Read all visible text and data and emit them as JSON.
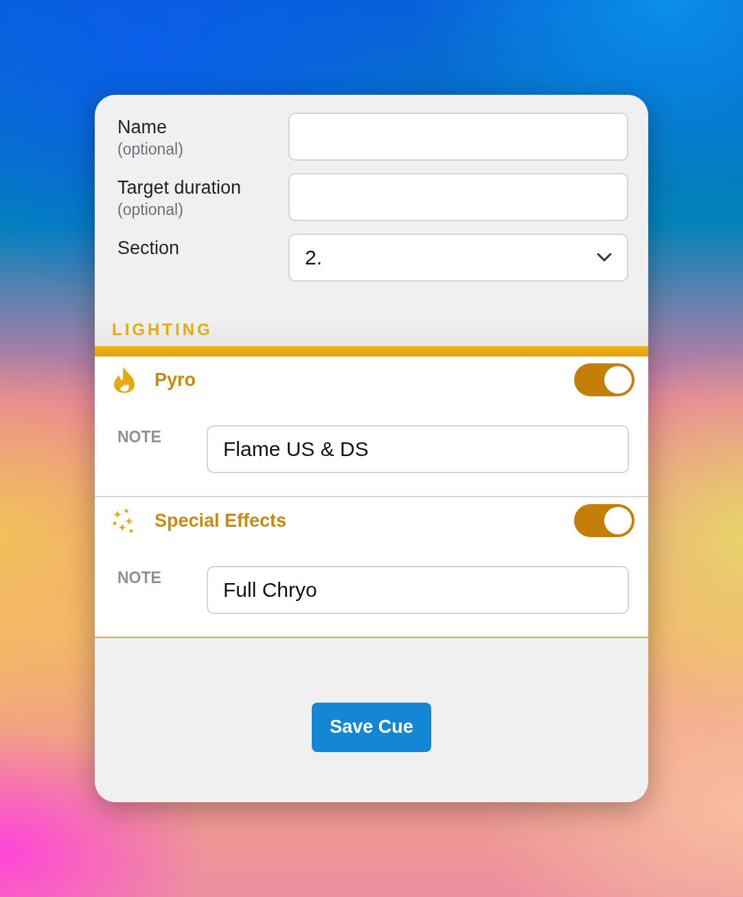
{
  "form_fields": [
    {
      "kind": "text",
      "label": "Name",
      "hint": "(optional)"
    },
    {
      "kind": "text",
      "label": "Target duration",
      "hint": "(optional)"
    },
    {
      "kind": "select",
      "label": "Section",
      "value": "2."
    }
  ],
  "section": {
    "title": "LIGHTING",
    "items": [
      {
        "kind": "pyro",
        "title": "Pyro",
        "on": true,
        "note_label": "NOTE",
        "note": "Flame US & DS"
      },
      {
        "kind": "effects",
        "title": "Special Effects",
        "on": true,
        "note_label": "NOTE",
        "note": "Full Chryo"
      }
    ]
  },
  "save_button": "Save Cue"
}
